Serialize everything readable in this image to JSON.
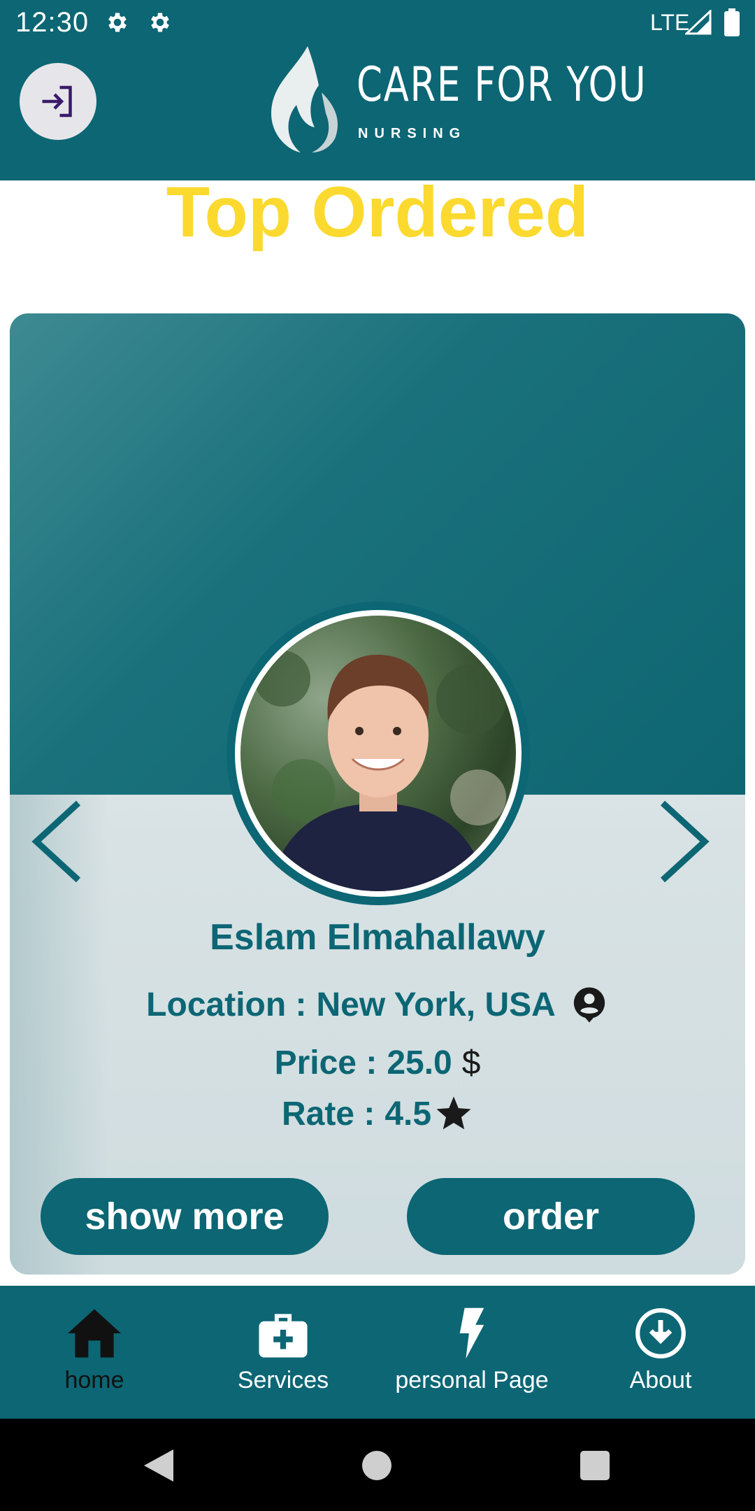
{
  "status_bar": {
    "time": "12:30",
    "network": "LTE"
  },
  "header": {
    "brand_title": "CARE FOR YOU",
    "brand_subtitle": "NURSING"
  },
  "page": {
    "title": "Top Ordered"
  },
  "nurse_card": {
    "name": "Eslam Elmahallawy",
    "location_label": "Location :",
    "location_value": "New York, USA",
    "price_label": "Price :",
    "price_value": "25.0",
    "price_currency": "$",
    "rate_label": "Rate :",
    "rate_value": "4.5",
    "show_more_label": "show more",
    "order_label": "order"
  },
  "bottom_nav": {
    "items": [
      {
        "label": "home",
        "icon": "home-icon",
        "active": true
      },
      {
        "label": "Services",
        "icon": "medical-bag-icon",
        "active": false
      },
      {
        "label": "personal Page",
        "icon": "lightning-icon",
        "active": false
      },
      {
        "label": "About",
        "icon": "download-circle-icon",
        "active": false
      }
    ]
  },
  "colors": {
    "primary": "#0c6674",
    "accent_yellow": "#fbd92f",
    "card_background": "#e3eaeb"
  }
}
